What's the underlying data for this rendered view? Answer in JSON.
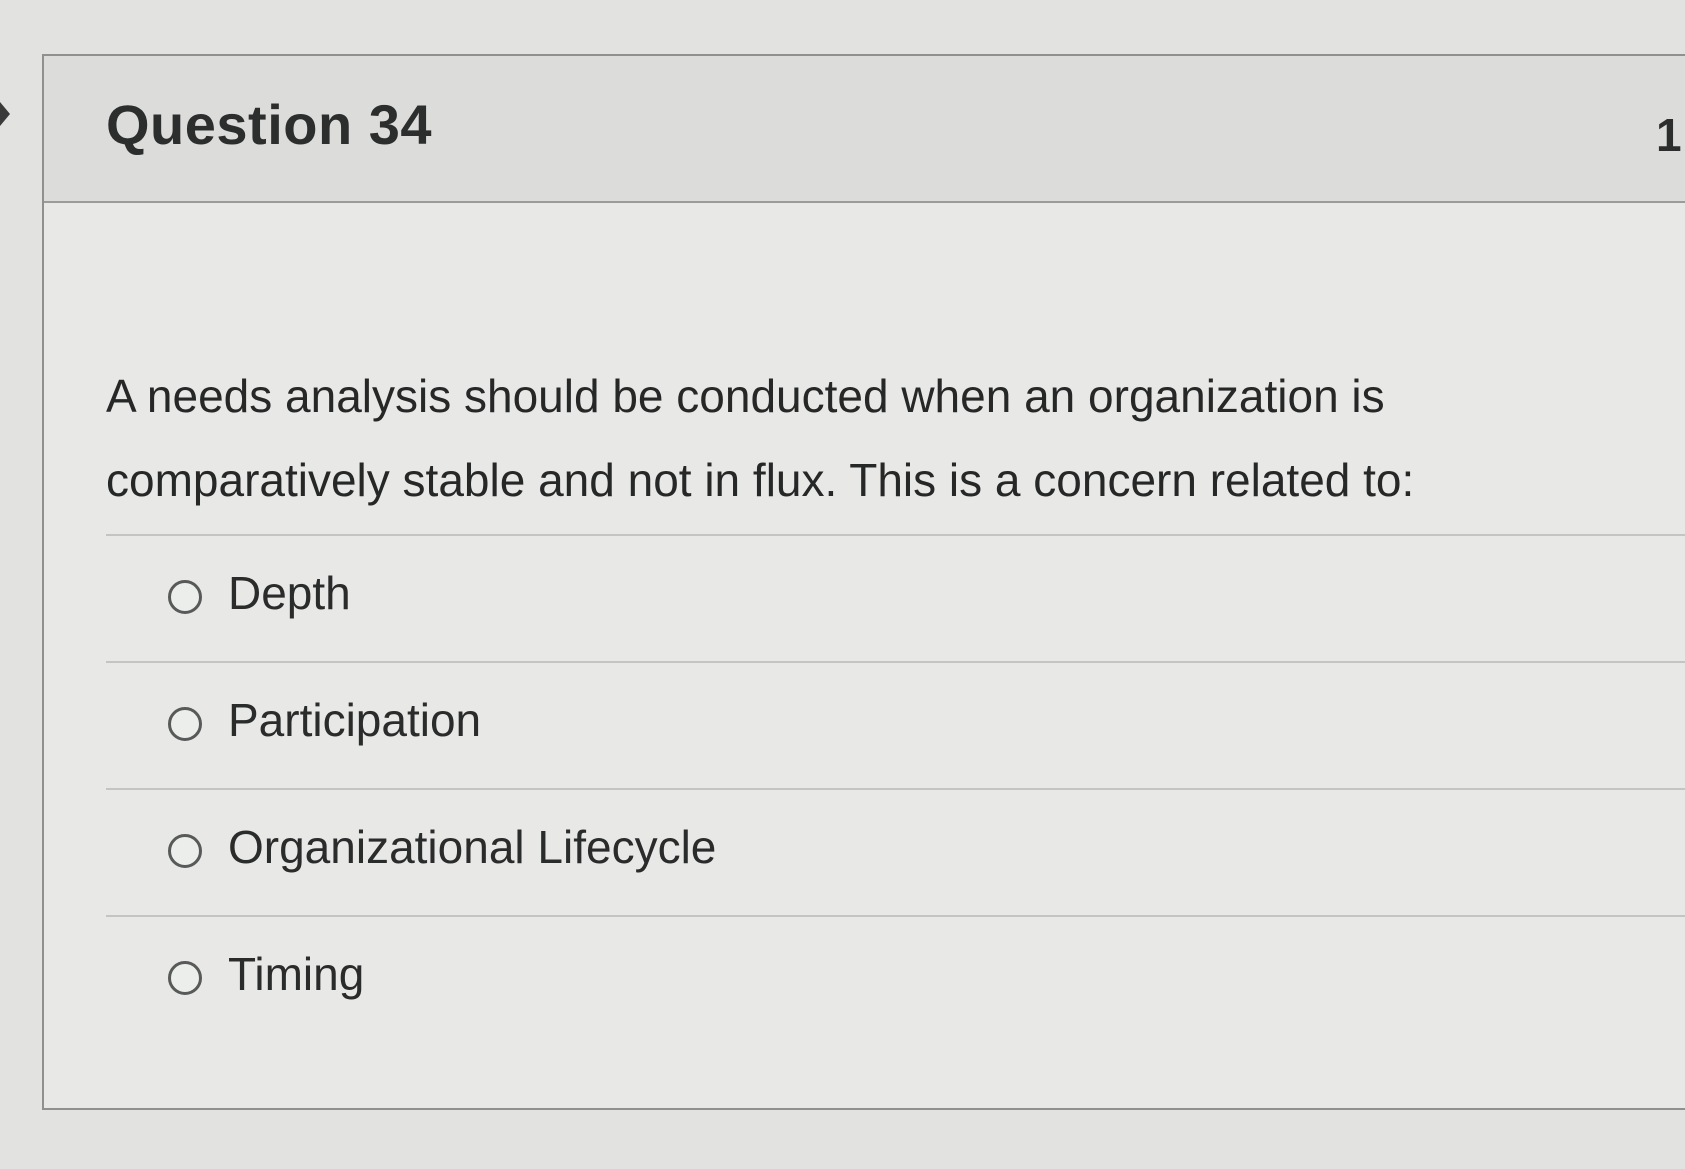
{
  "question": {
    "title": "Question 34",
    "points": "1",
    "text": "A needs analysis should be conducted when an organization is comparatively stable and not in flux. This is a concern related to:"
  },
  "answers": [
    {
      "label": "Depth"
    },
    {
      "label": "Participation"
    },
    {
      "label": "Organizational Lifecycle"
    },
    {
      "label": "Timing"
    }
  ]
}
